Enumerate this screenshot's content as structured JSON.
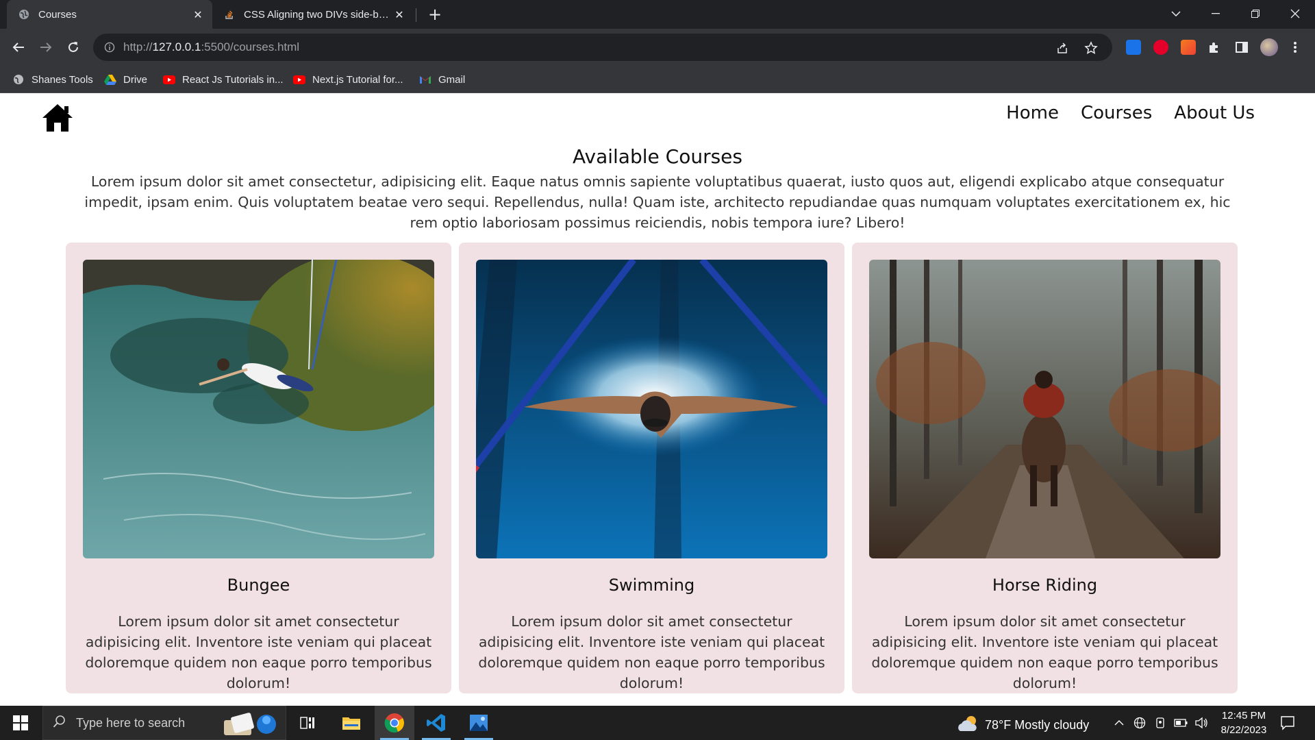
{
  "browser": {
    "tabs": [
      {
        "title": "Courses",
        "active": true,
        "icon": "globe-icon"
      },
      {
        "title": "CSS Aligning two DIVs side-by-side",
        "active": false,
        "icon": "stackoverflow-icon"
      }
    ],
    "url_prefix": "http://",
    "url_host": "127.0.0.1",
    "url_path": ":5500/courses.html",
    "bookmarks": [
      {
        "label": "Shanes Tools",
        "icon": "globe-icon"
      },
      {
        "label": "Drive",
        "icon": "google-drive-icon"
      },
      {
        "label": "React Js Tutorials in...",
        "icon": "youtube-icon"
      },
      {
        "label": "Next.js Tutorial for...",
        "icon": "youtube-icon"
      },
      {
        "label": "Gmail",
        "icon": "gmail-icon"
      }
    ]
  },
  "site": {
    "nav": [
      {
        "label": "Home"
      },
      {
        "label": "Courses"
      },
      {
        "label": "About Us"
      }
    ],
    "heading": "Available Courses",
    "intro": "Lorem ipsum dolor sit amet consectetur, adipisicing elit. Eaque natus omnis sapiente voluptatibus quaerat, iusto quos aut, eligendi explicabo atque consequatur impedit, ipsam enim. Quis voluptatem beatae vero sequi. Repellendus, nulla! Quam iste, architecto repudiandae quas numquam voluptates exercitationem ex, hic rem optio laboriosam possimus reiciendis, nobis tempora iure? Libero!",
    "courses": [
      {
        "title": "Bungee",
        "text": "Lorem ipsum dolor sit amet consectetur adipisicing elit. Inventore iste veniam qui placeat doloremque quidem non eaque porro temporibus dolorum!",
        "image": "bungee-jump-photo"
      },
      {
        "title": "Swimming",
        "text": "Lorem ipsum dolor sit amet consectetur adipisicing elit. Inventore iste veniam qui placeat doloremque quidem non eaque porro temporibus dolorum!",
        "image": "swimmer-photo"
      },
      {
        "title": "Horse Riding",
        "text": "Lorem ipsum dolor sit amet consectetur adipisicing elit. Inventore iste veniam qui placeat doloremque quidem non eaque porro temporibus dolorum!",
        "image": "horse-rider-forest-photo"
      }
    ],
    "colors": {
      "card_bg": "#f2e1e4",
      "text": "#333333"
    }
  },
  "taskbar": {
    "search_placeholder": "Type here to search",
    "weather": "78°F  Mostly cloudy",
    "time": "12:45 PM",
    "date": "8/22/2023"
  }
}
